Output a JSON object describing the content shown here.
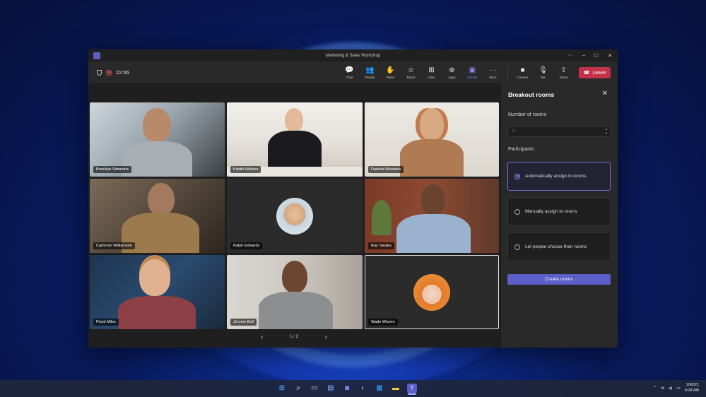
{
  "window": {
    "title": "Marketing & Sales Workshop",
    "controls": [
      "···",
      "–",
      "☐",
      "✕"
    ]
  },
  "meeting": {
    "timer": "22:06"
  },
  "toolbar": {
    "tools": [
      {
        "label": "Chat",
        "icon": "chat-icon"
      },
      {
        "label": "People",
        "icon": "people-icon"
      },
      {
        "label": "Raise",
        "icon": "raise-hand-icon"
      },
      {
        "label": "React",
        "icon": "react-icon"
      },
      {
        "label": "View",
        "icon": "view-icon"
      },
      {
        "label": "Apps",
        "icon": "apps-icon"
      },
      {
        "label": "Rooms",
        "icon": "rooms-icon",
        "active": true
      },
      {
        "label": "More",
        "icon": "more-icon"
      }
    ],
    "media": [
      {
        "label": "Camera",
        "icon": "camera-icon"
      },
      {
        "label": "Mic",
        "icon": "mic-icon"
      },
      {
        "label": "Share",
        "icon": "share-icon"
      }
    ],
    "leave_label": "Leave",
    "active_color": "#8b8ff0",
    "leave_color": "#c4314b"
  },
  "participants": [
    {
      "name": "Brooklyn Simmons"
    },
    {
      "name": "Kristin Watson"
    },
    {
      "name": "Daniela Mandera"
    },
    {
      "name": "Cameron Williamson"
    },
    {
      "name": "Ralph Edwards"
    },
    {
      "name": "Ray Tanaka"
    },
    {
      "name": "Floyd Miles"
    },
    {
      "name": "Jerome Bell"
    },
    {
      "name": "Wade Warren"
    }
  ],
  "pager": {
    "text": "1 / 2"
  },
  "panel": {
    "title": "Breakout rooms",
    "rooms_label": "Number of rooms",
    "rooms_value": "2",
    "participants_label": "Participants",
    "options": [
      {
        "label": "Automatically assign to rooms",
        "selected": true
      },
      {
        "label": "Manually assign to rooms",
        "selected": false
      },
      {
        "label": "Let people choose their rooms",
        "selected": false
      }
    ],
    "create_label": "Create rooms",
    "accent": "#5b5fc7"
  },
  "taskbar": {
    "date": "10/6/21",
    "time": "9:28 AM"
  }
}
